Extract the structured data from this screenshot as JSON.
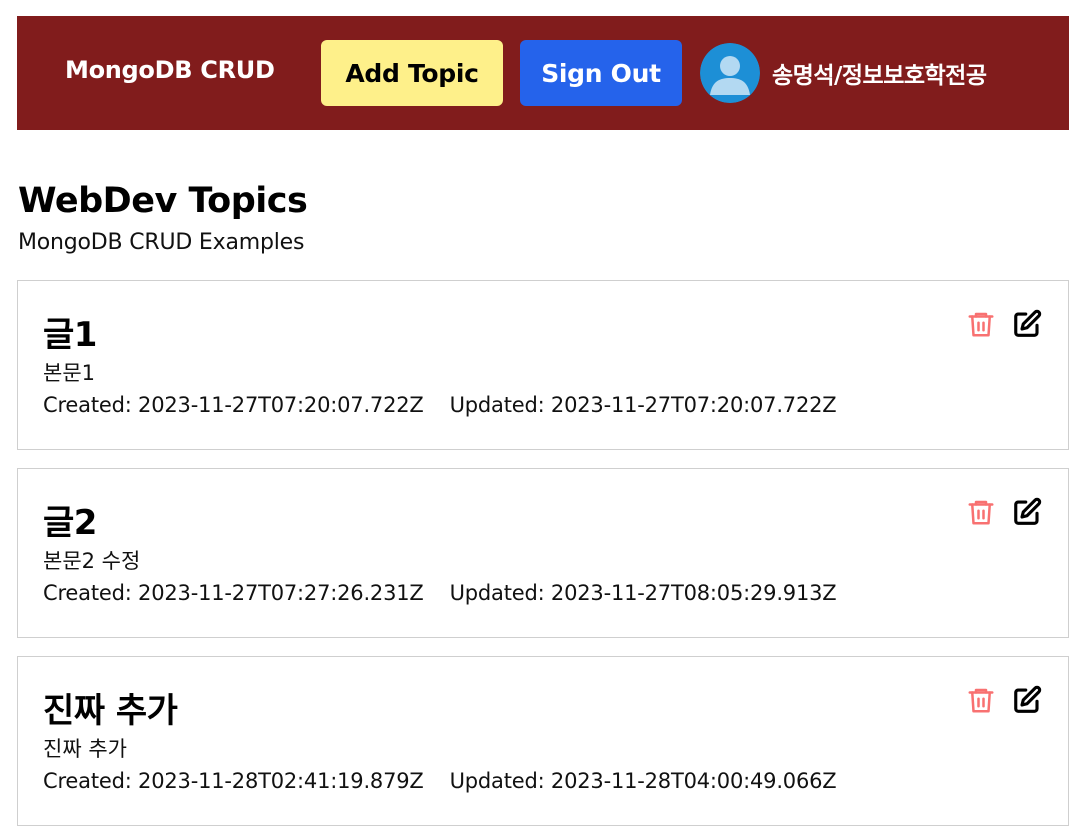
{
  "navbar": {
    "brand": "MongoDB CRUD",
    "add_topic_label": "Add Topic",
    "sign_out_label": "Sign Out",
    "user_name": "송명석/정보보호학전공"
  },
  "main": {
    "title": "WebDev Topics",
    "subtitle": "MongoDB CRUD Examples"
  },
  "topics": [
    {
      "title": "글1",
      "description": "본문1",
      "created": "Created: 2023-11-27T07:20:07.722Z",
      "updated": "Updated: 2023-11-27T07:20:07.722Z"
    },
    {
      "title": "글2",
      "description": "본문2 수정",
      "created": "Created: 2023-11-27T07:27:26.231Z",
      "updated": "Updated: 2023-11-27T08:05:29.913Z"
    },
    {
      "title": "진짜 추가",
      "description": "진짜 추가",
      "created": "Created: 2023-11-28T02:41:19.879Z",
      "updated": "Updated: 2023-11-28T04:00:49.066Z"
    }
  ],
  "icons": {
    "delete": "trash-icon",
    "edit": "edit-icon",
    "avatar": "user-avatar"
  },
  "colors": {
    "navbar_bg": "#811c1c",
    "add_button_bg": "#fef08a",
    "sign_out_button_bg": "#2563eb",
    "delete_icon": "#f87171"
  }
}
